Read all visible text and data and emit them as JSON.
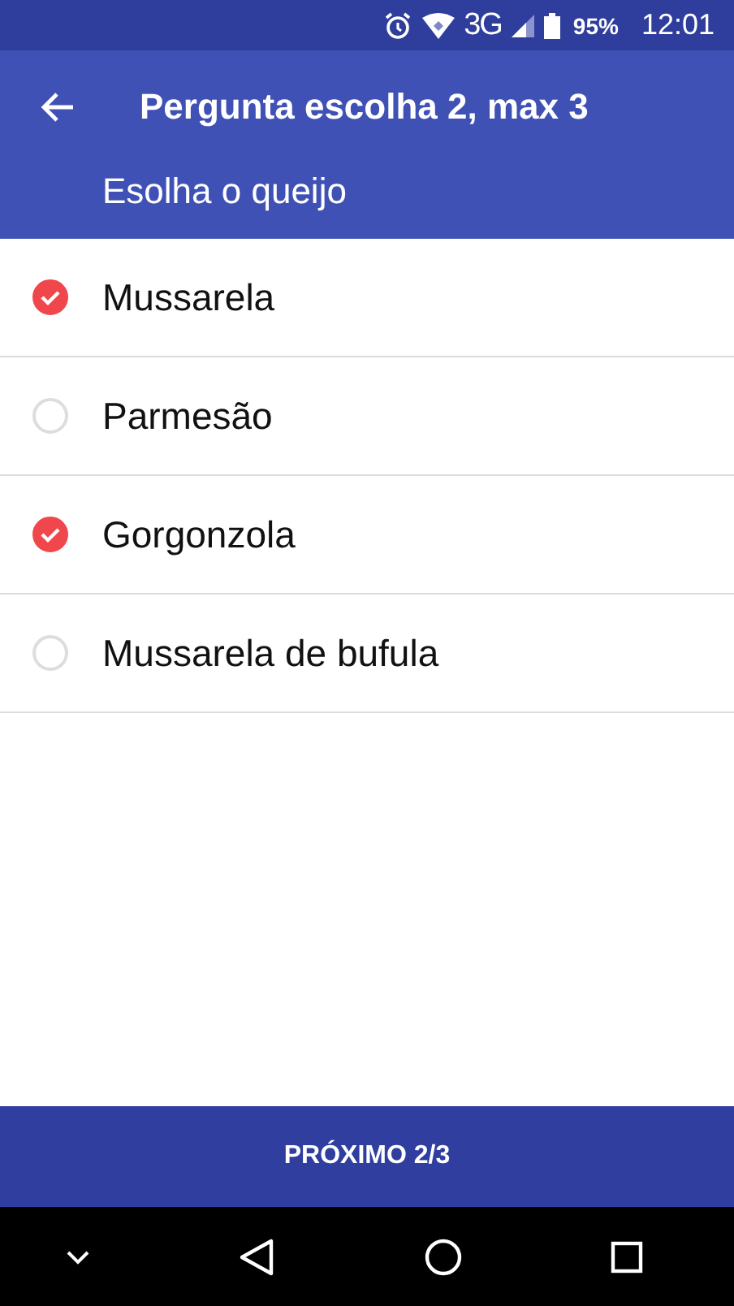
{
  "status_bar": {
    "network": "3G",
    "battery": "95%",
    "time": "12:01"
  },
  "header": {
    "title": "Pergunta escolha 2, max 3",
    "subtitle": "Esolha o queijo"
  },
  "options": [
    {
      "label": "Mussarela",
      "checked": true
    },
    {
      "label": "Parmesão",
      "checked": false
    },
    {
      "label": "Gorgonzola",
      "checked": true
    },
    {
      "label": "Mussarela de bufula",
      "checked": false
    }
  ],
  "next_button": {
    "label": "PRÓXIMO 2/3"
  }
}
